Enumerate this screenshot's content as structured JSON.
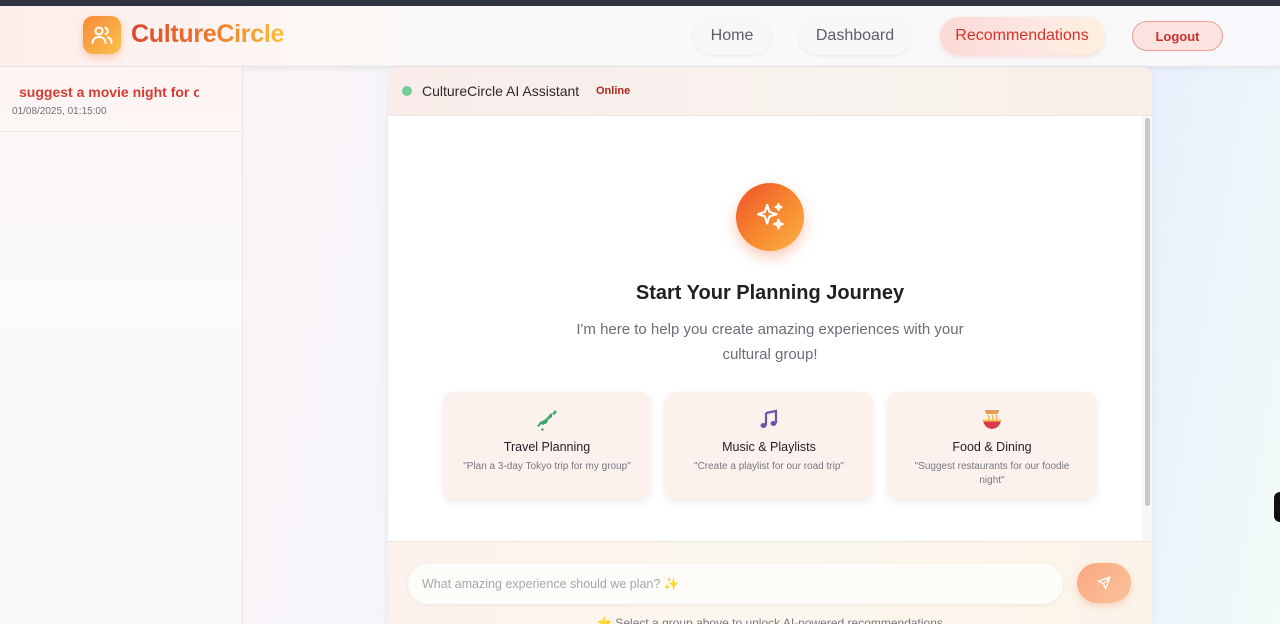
{
  "navbar": {
    "brand": "CultureCircle",
    "links": [
      {
        "label": "Home"
      },
      {
        "label": "Dashboard"
      },
      {
        "label": "Recommendations",
        "active": true
      }
    ],
    "logout_label": "Logout"
  },
  "sidebar": {
    "chats": [
      {
        "title": "suggest a movie night for our",
        "time": "01/08/2025, 01:15:00"
      }
    ]
  },
  "chat": {
    "assistant_name": "CultureCircle AI Assistant",
    "status": "Online",
    "hero_title": "Start Your Planning Journey",
    "hero_subtitle": "I'm here to help you create amazing experiences with your cultural group!",
    "cards": [
      {
        "icon": "japan-map-icon",
        "title": "Travel Planning",
        "desc": "\"Plan a 3-day Tokyo trip for my group\""
      },
      {
        "icon": "music-note-icon",
        "title": "Music & Playlists",
        "desc": "\"Create a playlist for our road trip\""
      },
      {
        "icon": "noodle-bowl-icon",
        "title": "Food & Dining",
        "desc": "\"Suggest restaurants for our foodie night\""
      }
    ],
    "input_placeholder": "What amazing experience should we plan? ✨",
    "hint": "⭐ Select a group above to unlock AI-powered recommendations"
  },
  "colors": {
    "accent": "#d5342d",
    "brand_gradient_start": "#f0502c",
    "brand_gradient_end": "#fbb24a",
    "online": "#6fcf97"
  }
}
